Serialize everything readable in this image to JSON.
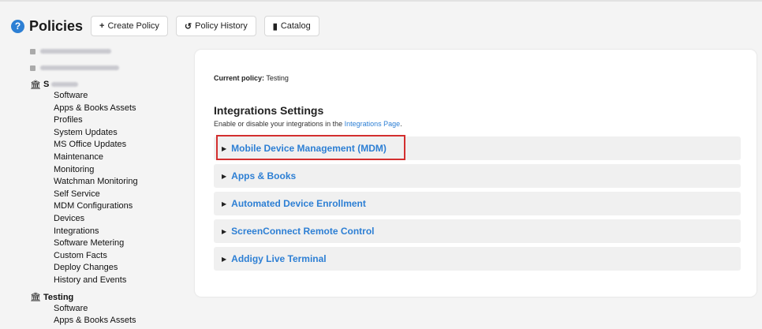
{
  "header": {
    "title": "Policies",
    "help_icon": "?",
    "buttons": [
      {
        "icon": "+",
        "label": "Create Policy"
      },
      {
        "icon": "history-icon",
        "label": "Policy History"
      },
      {
        "icon": "book-icon",
        "label": "Catalog"
      }
    ]
  },
  "sidebar": {
    "group1": {
      "label": "S",
      "items": [
        "Software",
        "Apps & Books Assets",
        "Profiles",
        "System Updates",
        "MS Office Updates",
        "Maintenance",
        "Monitoring",
        "Watchman Monitoring",
        "Self Service",
        "MDM Configurations",
        "Devices",
        "Integrations",
        "Software Metering",
        "Custom Facts",
        "Deploy Changes",
        "History and Events"
      ]
    },
    "group2": {
      "label": "Testing",
      "items": [
        "Software",
        "Apps & Books Assets"
      ]
    }
  },
  "main": {
    "current_policy_label": "Current policy:",
    "current_policy_value": "Testing",
    "section_title": "Integrations Settings",
    "section_desc": "Enable or disable your integrations in the",
    "section_link": "Integrations Page",
    "section_desc_end": ".",
    "accordions": [
      "Mobile Device Management (MDM)",
      "Apps & Books",
      "Automated Device Enrollment",
      "ScreenConnect Remote Control",
      "Addigy Live Terminal"
    ],
    "highlight_color": "#d32f2f",
    "accent_color": "#2d7fd4"
  }
}
